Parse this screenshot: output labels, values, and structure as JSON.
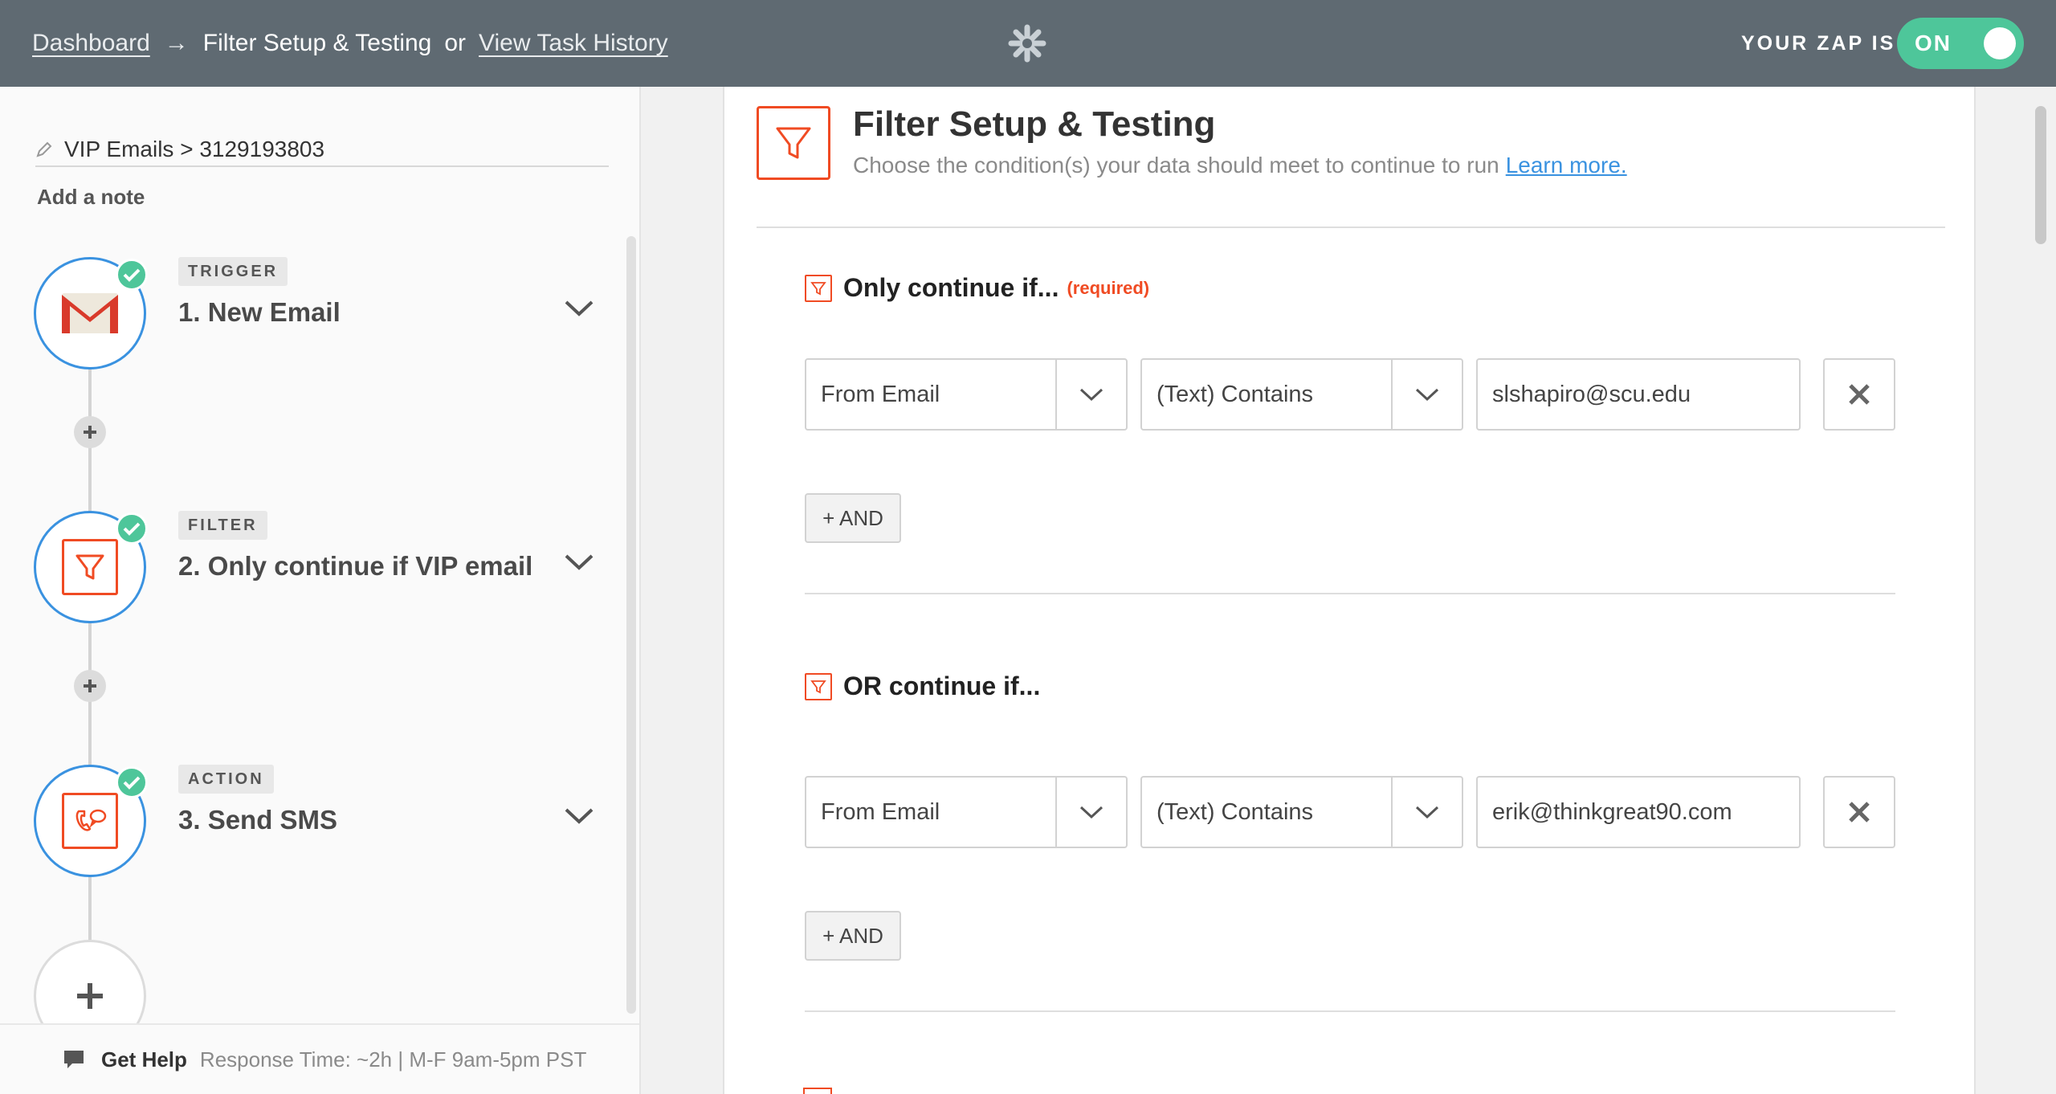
{
  "topbar": {
    "dashboard": "Dashboard",
    "arrow": "→",
    "current": "Filter Setup & Testing",
    "or": "or",
    "history": "View Task History",
    "zap_status_label": "YOUR ZAP IS",
    "toggle": "ON"
  },
  "sidebar": {
    "zap_name": "VIP Emails > 3129193803",
    "add_note": "Add a note",
    "steps": [
      {
        "badge": "TRIGGER",
        "title": "1. New Email",
        "icon": "gmail-icon"
      },
      {
        "badge": "FILTER",
        "title": "2. Only continue if VIP email",
        "icon": "filter-icon"
      },
      {
        "badge": "ACTION",
        "title": "3. Send SMS",
        "icon": "sms-icon"
      }
    ],
    "help": {
      "link": "Get Help",
      "info": "Response Time: ~2h | M-F 9am-5pm PST"
    }
  },
  "main": {
    "title": "Filter Setup & Testing",
    "subtitle": "Choose the condition(s) your data should meet to continue to run",
    "learn_more": "Learn more.",
    "groups": [
      {
        "label": "Only continue if...",
        "required": "(required)",
        "field": "From Email",
        "operator": "(Text) Contains",
        "value": "slshapiro@scu.edu",
        "and_button": "+ AND"
      },
      {
        "label": "OR continue if...",
        "required": "",
        "field": "From Email",
        "operator": "(Text) Contains",
        "value": "erik@thinkgreat90.com",
        "and_button": "+ AND"
      }
    ]
  },
  "colors": {
    "topbar": "#5f6a72",
    "accent_orange": "#f04b23",
    "toggle_green": "#4ec69a",
    "timeline_blue": "#3a92e0"
  }
}
